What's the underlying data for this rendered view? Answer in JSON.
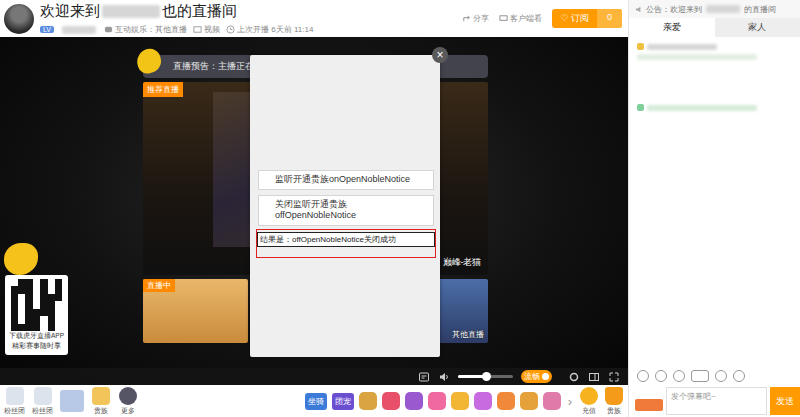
{
  "header": {
    "title_prefix": "欢迎来到",
    "title_suffix": "也的直播间",
    "level_badge": "LV",
    "category": "互动娱乐：其他直播",
    "video_link": "视频",
    "last_live": "上次开播 6天前 11:14",
    "share": "分享",
    "client": "客户端看",
    "subscribe": {
      "label": "订阅",
      "count": "0"
    }
  },
  "video": {
    "announce": "直播预告：主播正在赶来",
    "recommend_tag": "推荐直播",
    "featured_name": "巅峰-老猫",
    "cards": [
      {
        "kind": "live",
        "tag": "直播中"
      },
      {
        "kind": "plain",
        "caption": "其他直播"
      },
      {
        "kind": "plain",
        "caption": "其他直播"
      }
    ]
  },
  "dialog": {
    "close": "×",
    "buttons": [
      "监听开通贵族onOpenNobleNotice",
      "关闭监听开通贵族offOpenNobleNotice"
    ],
    "result": "结果是：offOpenNobleNotice关闭成功"
  },
  "qr_card": {
    "line1": "下载虎牙直播APP",
    "line2": "精彩赛事随时享"
  },
  "player_controls": {
    "volume": {
      "level": 0.5
    },
    "quality": "流畅"
  },
  "bottom_bar": {
    "items": [
      {
        "kind": "fan",
        "label": "粉丝团"
      },
      {
        "kind": "fan",
        "label": "粉丝团"
      },
      {
        "kind": "avatar"
      },
      {
        "kind": "noble",
        "label": "贵族"
      },
      {
        "kind": "more",
        "label": "更多"
      }
    ],
    "gifts": [
      {
        "label": "坐骑",
        "color": "#3d7bd9"
      },
      {
        "label": "团宠",
        "color": "#6b4fd1"
      },
      {
        "color": "#d9a441"
      },
      {
        "color": "#e8506a"
      },
      {
        "color": "#9b59d0"
      },
      {
        "color": "#f06aa0"
      },
      {
        "color": "#f3b534"
      },
      {
        "color": "#c86be0"
      },
      {
        "color": "#f08a3a"
      },
      {
        "color": "#e5a23a"
      },
      {
        "color": "#e07aa8"
      }
    ],
    "next": "›",
    "recharge": "充值",
    "noble": "贵族"
  },
  "sidebar": {
    "notice_prefix": "公告：欢迎来到",
    "notice_suffix": "的直播间",
    "tabs": [
      {
        "label": "亲爱",
        "selected": true
      },
      {
        "label": "家人",
        "selected": false
      }
    ],
    "placeholder": "发个弹幕吧~",
    "send": "发送"
  }
}
